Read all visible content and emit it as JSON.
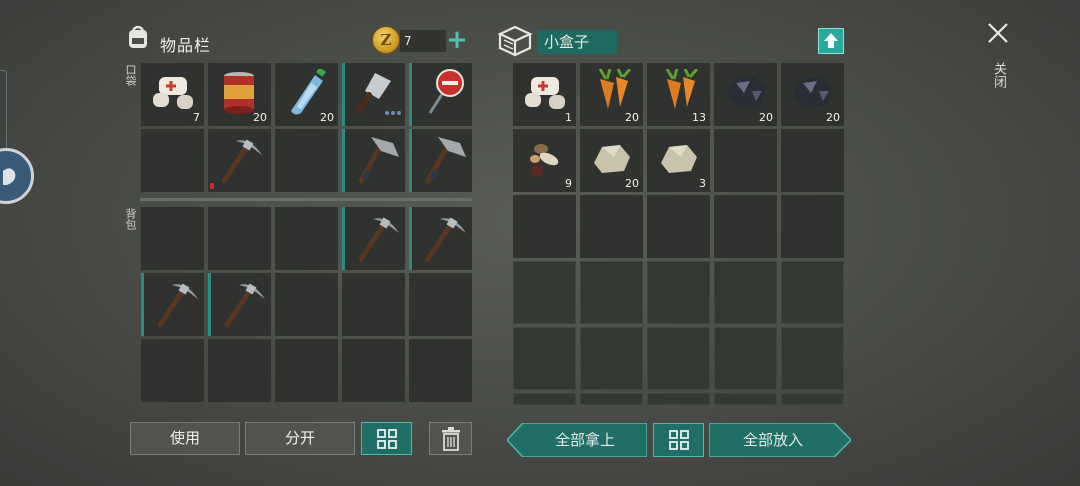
{
  "inventory": {
    "title": "物品栏",
    "coins": "7",
    "pocket_label": "口袋",
    "backpack_label": "背包",
    "pocket_counts": [
      "7",
      "20",
      "20",
      "",
      "",
      "",
      "",
      "",
      ""
    ],
    "use_label": "使用",
    "split_label": "分开"
  },
  "box": {
    "title": "小盒子",
    "counts": [
      "1",
      "20",
      "13",
      "20",
      "20",
      "9",
      "20",
      "3"
    ],
    "take_all_label": "全部拿上",
    "put_all_label": "全部放入"
  },
  "close_label": "关闭",
  "colors": {
    "accent": "#2aa89a",
    "teal_dark": "#1f6f66",
    "slot": "#2f322e"
  },
  "icons": [
    "backpack-icon",
    "coin-icon",
    "plus-icon",
    "box-icon",
    "upload-icon",
    "close-icon",
    "grid-sort-icon",
    "trash-icon"
  ]
}
